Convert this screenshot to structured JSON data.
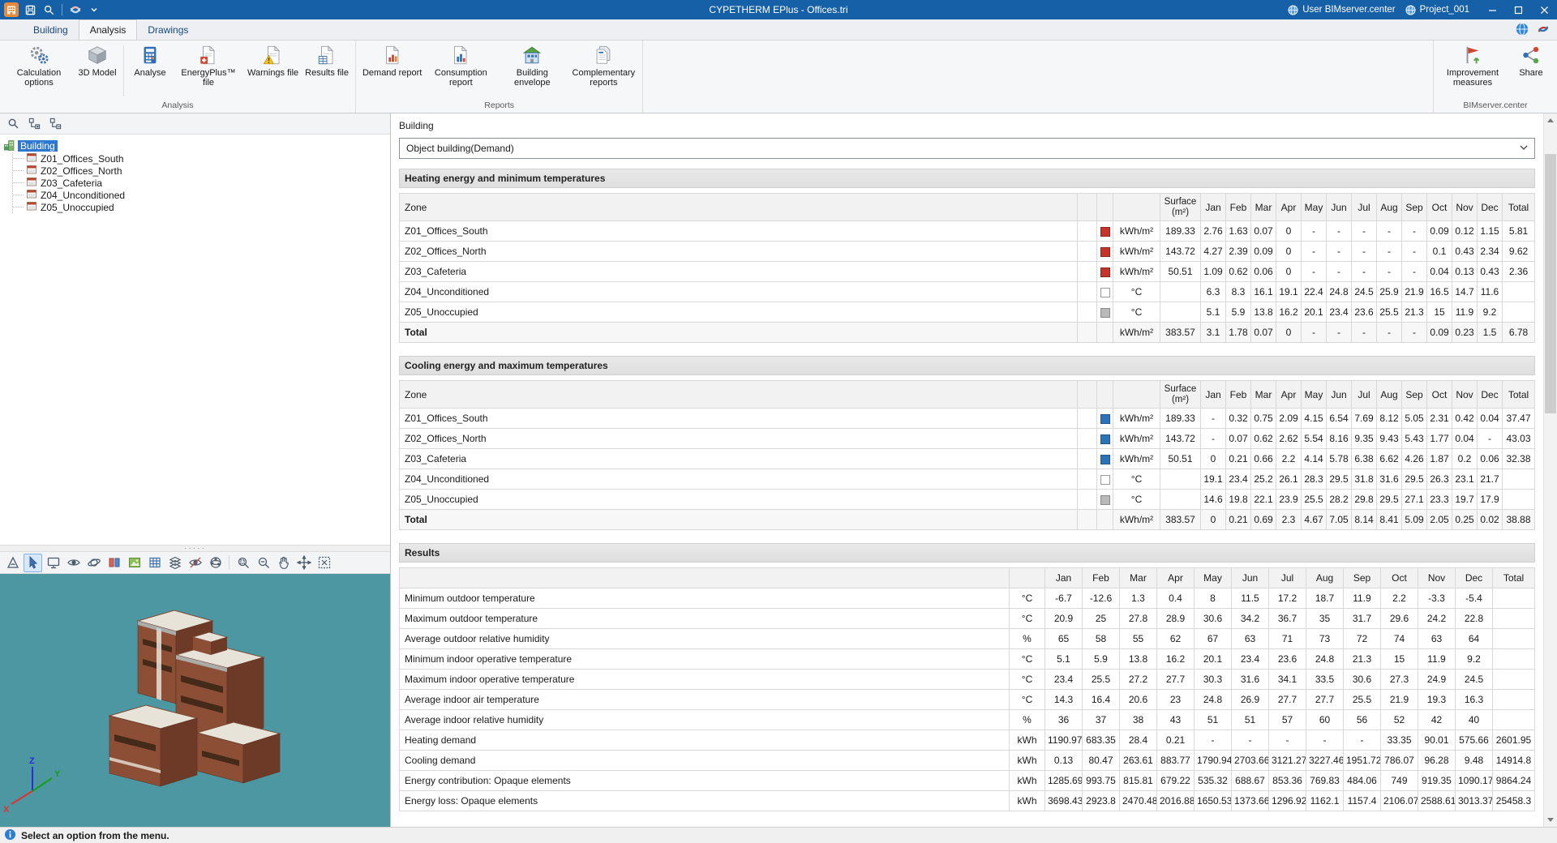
{
  "titlebar": {
    "title": "CYPETHERM EPlus - Offices.tri",
    "user_label": "User BIMserver.center",
    "project_label": "Project_001"
  },
  "tabs": [
    {
      "label": "Building"
    },
    {
      "label": "Analysis"
    },
    {
      "label": "Drawings"
    }
  ],
  "ribbon": {
    "groups": [
      {
        "label": "Analysis",
        "buttons": [
          {
            "label": "Calculation options",
            "icon": "gears-icon"
          },
          {
            "label": "3D Model",
            "icon": "cube-icon"
          },
          {
            "label": "Analyse",
            "icon": "calculator-icon"
          },
          {
            "label": "EnergyPlus™ file",
            "icon": "energyplus-file-icon"
          },
          {
            "label": "Warnings file",
            "icon": "warnings-file-icon"
          },
          {
            "label": "Results file",
            "icon": "results-file-icon"
          }
        ]
      },
      {
        "label": "Reports",
        "buttons": [
          {
            "label": "Demand report",
            "icon": "demand-report-icon"
          },
          {
            "label": "Consumption report",
            "icon": "consumption-report-icon"
          },
          {
            "label": "Building envelope",
            "icon": "building-envelope-icon"
          },
          {
            "label": "Complementary reports",
            "icon": "complementary-reports-icon"
          }
        ]
      },
      {
        "label": "BIMserver.center",
        "buttons": [
          {
            "label": "Improvement measures",
            "icon": "improvement-measures-icon"
          },
          {
            "label": "Share",
            "icon": "share-icon"
          }
        ]
      }
    ]
  },
  "tree": {
    "root": "Building",
    "items": [
      "Z01_Offices_South",
      "Z02_Offices_North",
      "Z03_Cafeteria",
      "Z04_Unconditioned",
      "Z05_Unoccupied"
    ]
  },
  "panel": {
    "title": "Building",
    "dropdown_value": "Object building(Demand)"
  },
  "months": [
    "Jan",
    "Feb",
    "Mar",
    "Apr",
    "May",
    "Jun",
    "Jul",
    "Aug",
    "Sep",
    "Oct",
    "Nov",
    "Dec"
  ],
  "total_label": "Total",
  "tables": {
    "heating": {
      "title": "Heating energy and minimum temperatures",
      "zone_header": "Zone",
      "surface_header": "Surface (m²)",
      "rows": [
        {
          "name": "Z01_Offices_South",
          "icon": "red",
          "unit": "kWh/m²",
          "surface": "189.33",
          "values": [
            "2.76",
            "1.63",
            "0.07",
            "0",
            "-",
            "-",
            "-",
            "-",
            "-",
            "0.09",
            "0.12",
            "1.15",
            "5.81"
          ]
        },
        {
          "name": "Z02_Offices_North",
          "icon": "red",
          "unit": "kWh/m²",
          "surface": "143.72",
          "values": [
            "4.27",
            "2.39",
            "0.09",
            "0",
            "-",
            "-",
            "-",
            "-",
            "-",
            "0.1",
            "0.43",
            "2.34",
            "9.62"
          ]
        },
        {
          "name": "Z03_Cafeteria",
          "icon": "red",
          "unit": "kWh/m²",
          "surface": "50.51",
          "values": [
            "1.09",
            "0.62",
            "0.06",
            "0",
            "-",
            "-",
            "-",
            "-",
            "-",
            "0.04",
            "0.13",
            "0.43",
            "2.36"
          ]
        },
        {
          "name": "Z04_Unconditioned",
          "icon": "white",
          "unit": "°C",
          "surface": "",
          "values": [
            "6.3",
            "8.3",
            "16.1",
            "19.1",
            "22.4",
            "24.8",
            "24.5",
            "25.9",
            "21.9",
            "16.5",
            "14.7",
            "11.6",
            ""
          ]
        },
        {
          "name": "Z05_Unoccupied",
          "icon": "gray",
          "unit": "°C",
          "surface": "",
          "values": [
            "5.1",
            "5.9",
            "13.8",
            "16.2",
            "20.1",
            "23.4",
            "23.6",
            "25.5",
            "21.3",
            "15",
            "11.9",
            "9.2",
            ""
          ]
        },
        {
          "name": "Total",
          "icon": "none",
          "unit": "kWh/m²",
          "surface": "383.57",
          "total": true,
          "values": [
            "3.1",
            "1.78",
            "0.07",
            "0",
            "-",
            "-",
            "-",
            "-",
            "-",
            "0.09",
            "0.23",
            "1.5",
            "6.78"
          ]
        }
      ]
    },
    "cooling": {
      "title": "Cooling energy and maximum temperatures",
      "zone_header": "Zone",
      "surface_header": "Surface (m²)",
      "rows": [
        {
          "name": "Z01_Offices_South",
          "icon": "blue",
          "unit": "kWh/m²",
          "surface": "189.33",
          "values": [
            "-",
            "0.32",
            "0.75",
            "2.09",
            "4.15",
            "6.54",
            "7.69",
            "8.12",
            "5.05",
            "2.31",
            "0.42",
            "0.04",
            "37.47"
          ]
        },
        {
          "name": "Z02_Offices_North",
          "icon": "blue",
          "unit": "kWh/m²",
          "surface": "143.72",
          "values": [
            "-",
            "0.07",
            "0.62",
            "2.62",
            "5.54",
            "8.16",
            "9.35",
            "9.43",
            "5.43",
            "1.77",
            "0.04",
            "-",
            "43.03"
          ]
        },
        {
          "name": "Z03_Cafeteria",
          "icon": "blue",
          "unit": "kWh/m²",
          "surface": "50.51",
          "values": [
            "0",
            "0.21",
            "0.66",
            "2.2",
            "4.14",
            "5.78",
            "6.38",
            "6.62",
            "4.26",
            "1.87",
            "0.2",
            "0.06",
            "32.38"
          ]
        },
        {
          "name": "Z04_Unconditioned",
          "icon": "white",
          "unit": "°C",
          "surface": "",
          "values": [
            "19.1",
            "23.4",
            "25.2",
            "26.1",
            "28.3",
            "29.5",
            "31.8",
            "31.6",
            "29.5",
            "26.3",
            "23.1",
            "21.7",
            ""
          ]
        },
        {
          "name": "Z05_Unoccupied",
          "icon": "gray",
          "unit": "°C",
          "surface": "",
          "values": [
            "14.6",
            "19.8",
            "22.1",
            "23.9",
            "25.5",
            "28.2",
            "29.8",
            "29.5",
            "27.1",
            "23.3",
            "19.7",
            "17.9",
            ""
          ]
        },
        {
          "name": "Total",
          "icon": "none",
          "unit": "kWh/m²",
          "surface": "383.57",
          "total": true,
          "values": [
            "0",
            "0.21",
            "0.69",
            "2.3",
            "4.67",
            "7.05",
            "8.14",
            "8.41",
            "5.09",
            "2.05",
            "0.25",
            "0.02",
            "38.88"
          ]
        }
      ]
    },
    "results": {
      "title": "Results",
      "rows": [
        {
          "name": "Minimum outdoor temperature",
          "unit": "°C",
          "values": [
            "-6.7",
            "-12.6",
            "1.3",
            "0.4",
            "8",
            "11.5",
            "17.2",
            "18.7",
            "11.9",
            "2.2",
            "-3.3",
            "-5.4",
            ""
          ]
        },
        {
          "name": "Maximum outdoor temperature",
          "unit": "°C",
          "values": [
            "20.9",
            "25",
            "27.8",
            "28.9",
            "30.6",
            "34.2",
            "36.7",
            "35",
            "31.7",
            "29.6",
            "24.2",
            "22.8",
            ""
          ]
        },
        {
          "name": "Average outdoor relative humidity",
          "unit": "%",
          "values": [
            "65",
            "58",
            "55",
            "62",
            "67",
            "63",
            "71",
            "73",
            "72",
            "74",
            "63",
            "64",
            ""
          ]
        },
        {
          "name": "Minimum indoor operative temperature",
          "unit": "°C",
          "values": [
            "5.1",
            "5.9",
            "13.8",
            "16.2",
            "20.1",
            "23.4",
            "23.6",
            "24.8",
            "21.3",
            "15",
            "11.9",
            "9.2",
            ""
          ]
        },
        {
          "name": "Maximum indoor operative temperature",
          "unit": "°C",
          "values": [
            "23.4",
            "25.5",
            "27.2",
            "27.7",
            "30.3",
            "31.6",
            "34.1",
            "33.5",
            "30.6",
            "27.3",
            "24.9",
            "24.5",
            ""
          ]
        },
        {
          "name": "Average indoor air temperature",
          "unit": "°C",
          "values": [
            "14.3",
            "16.4",
            "20.6",
            "23",
            "24.8",
            "26.9",
            "27.7",
            "27.7",
            "25.5",
            "21.9",
            "19.3",
            "16.3",
            ""
          ]
        },
        {
          "name": "Average indoor relative humidity",
          "unit": "%",
          "values": [
            "36",
            "37",
            "38",
            "43",
            "51",
            "51",
            "57",
            "60",
            "56",
            "52",
            "42",
            "40",
            ""
          ]
        },
        {
          "name": "Heating demand",
          "unit": "kWh",
          "values": [
            "1190.97",
            "683.35",
            "28.4",
            "0.21",
            "-",
            "-",
            "-",
            "-",
            "-",
            "33.35",
            "90.01",
            "575.66",
            "2601.95"
          ]
        },
        {
          "name": "Cooling demand",
          "unit": "kWh",
          "values": [
            "0.13",
            "80.47",
            "263.61",
            "883.77",
            "1790.94",
            "2703.66",
            "3121.27",
            "3227.46",
            "1951.72",
            "786.07",
            "96.28",
            "9.48",
            "14914.8"
          ]
        },
        {
          "name": "Energy contribution: Opaque elements",
          "unit": "kWh",
          "values": [
            "1285.69",
            "993.75",
            "815.81",
            "679.22",
            "535.32",
            "688.67",
            "853.36",
            "769.83",
            "484.06",
            "749",
            "919.35",
            "1090.17",
            "9864.24"
          ]
        },
        {
          "name": "Energy loss: Opaque elements",
          "unit": "kWh",
          "values": [
            "3698.43",
            "2923.8",
            "2470.48",
            "2016.88",
            "1650.53",
            "1373.66",
            "1296.92",
            "1162.1",
            "1157.4",
            "2106.07",
            "2588.61",
            "3013.37",
            "25458.3"
          ]
        }
      ]
    }
  },
  "statusbar": {
    "message": "Select an option from the menu."
  }
}
